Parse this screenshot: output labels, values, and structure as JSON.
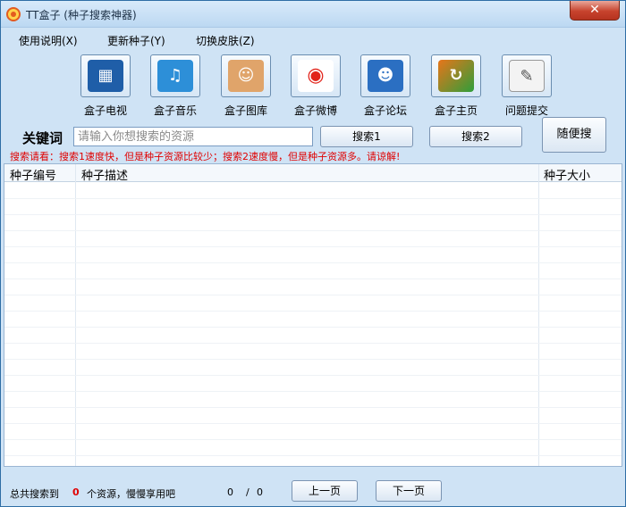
{
  "window": {
    "title": "TT盒子 (种子搜索神器)",
    "close_label": "✕"
  },
  "menu": {
    "items": [
      {
        "label": "使用说明(X)"
      },
      {
        "label": "更新种子(Y)"
      },
      {
        "label": "切换皮肤(Z)"
      }
    ]
  },
  "toolbar": {
    "items": [
      {
        "label": "盒子电视",
        "icon": "film-icon",
        "color": "#1f5ea8"
      },
      {
        "label": "盒子音乐",
        "icon": "music-note-icon",
        "color": "#2d8fd8"
      },
      {
        "label": "盒子图库",
        "icon": "portrait-icon",
        "color": "#e0a46a"
      },
      {
        "label": "盒子微博",
        "icon": "weibo-icon",
        "color": "#e2231a"
      },
      {
        "label": "盒子论坛",
        "icon": "people-icon",
        "color": "#2b6fc2"
      },
      {
        "label": "盒子主页",
        "icon": "home-icon",
        "color": "#e8751a"
      },
      {
        "label": "问题提交",
        "icon": "notepad-icon",
        "color": "#8b8f95"
      }
    ]
  },
  "search": {
    "keyword_label": "关键词",
    "placeholder": "请输入你想搜索的资源",
    "button1": "搜索1",
    "button2": "搜索2",
    "random_button": "随便搜",
    "notice": "搜索请看：搜索1速度快，但是种子资源比较少；搜索2速度慢，但是种子资源多。请谅解!"
  },
  "table": {
    "columns": [
      "种子编号",
      "种子描述",
      "种子大小"
    ]
  },
  "status": {
    "prefix": "总共搜索到",
    "count": "0",
    "suffix": "个资源，慢慢享用吧",
    "page": "0",
    "sep": "/",
    "total": "0",
    "prev": "上一页",
    "next": "下一页"
  }
}
